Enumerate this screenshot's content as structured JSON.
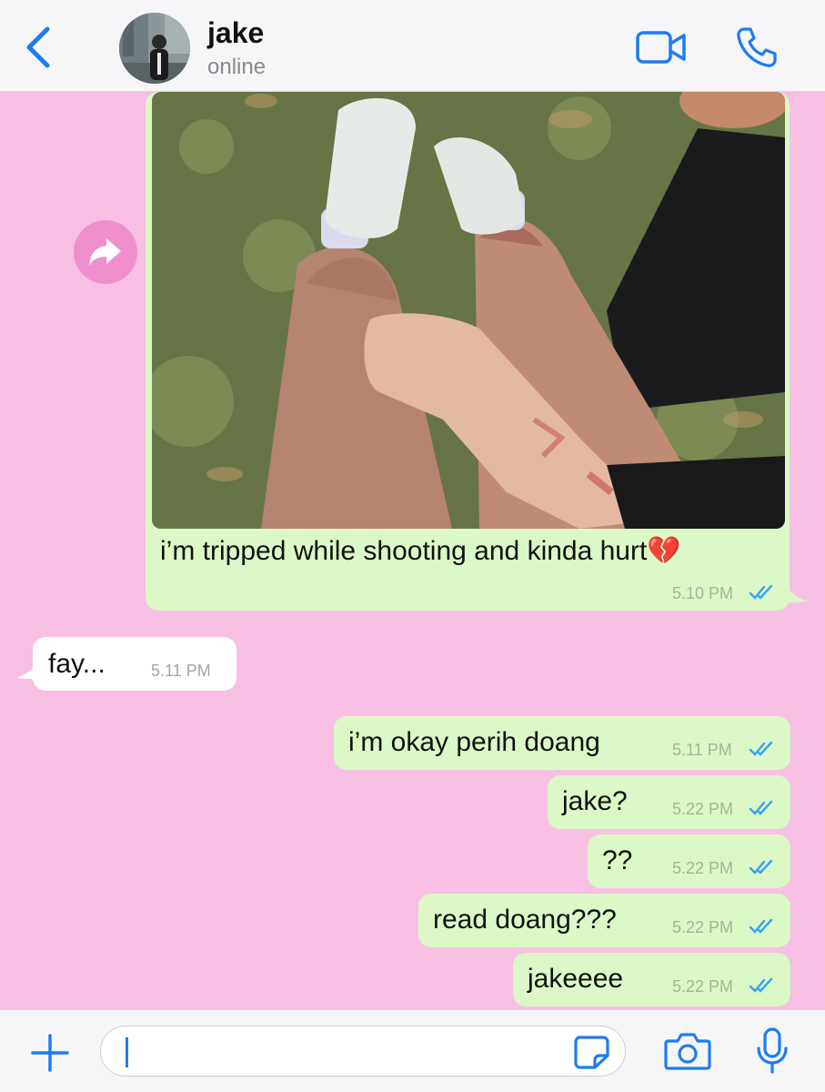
{
  "header": {
    "contact_name": "jake",
    "status": "online"
  },
  "messages": [
    {
      "type": "photo",
      "direction": "outgoing",
      "caption": "i’m tripped while shooting and kinda hurt💔",
      "time": "5.10 PM",
      "read": true
    },
    {
      "direction": "incoming",
      "text": "fay...",
      "time": "5.11 PM"
    },
    {
      "direction": "outgoing",
      "text": "i’m okay perih doang",
      "time": "5.11 PM",
      "read": true
    },
    {
      "direction": "outgoing",
      "text": "jake?",
      "time": "5.22 PM",
      "read": true
    },
    {
      "direction": "outgoing",
      "text": "??",
      "time": "5.22 PM",
      "read": true
    },
    {
      "direction": "outgoing",
      "text": "read doang???",
      "time": "5.22 PM",
      "read": true
    },
    {
      "direction": "outgoing",
      "text": "jakeeee",
      "time": "5.22 PM",
      "read": true
    }
  ],
  "input": {
    "value": ""
  },
  "colors": {
    "chat_background": "#f7c0e3",
    "outgoing_bubble": "#dcf8c6",
    "incoming_bubble": "#ffffff",
    "accent": "#1f7cf0",
    "read_ticks": "#34a4f5",
    "forward_button": "#ef8fcb"
  },
  "icons": {
    "back": "chevron-left-icon",
    "video_call": "video-camera-icon",
    "voice_call": "phone-icon",
    "forward": "share-arrow-icon",
    "attach": "plus-icon",
    "sticker": "sticker-icon",
    "camera": "camera-icon",
    "microphone": "microphone-icon"
  }
}
